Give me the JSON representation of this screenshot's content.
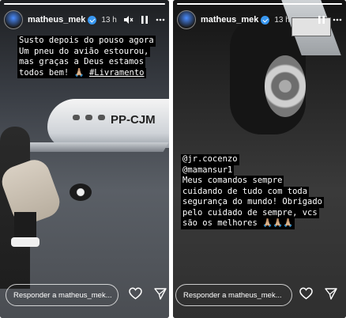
{
  "stories": [
    {
      "username": "matheus_mek",
      "time": "13 h",
      "progress": 1.0,
      "caption": [
        "Susto depois do pouso agora",
        "Um pneu do avião estourou,",
        "mas graças a Deus estamos",
        "todos bem! 🙏🏼"
      ],
      "hashtag": "#Livramento",
      "aircraft_registration": "PP-CJM",
      "reply_placeholder": "Responder a matheus_mek...",
      "icons": [
        "mute-icon",
        "pause-icon",
        "more-icon",
        "heart-icon",
        "send-icon"
      ]
    },
    {
      "username": "matheus_mek",
      "time": "13 h",
      "progress": 1.0,
      "caption": [
        "@jr.cocenzo",
        "@mamansur1",
        "Meus comandos sempre",
        "cuidando de tudo com toda",
        "segurança do mundo! Obrigado",
        "pelo cuidado de sempre, vcs",
        "são os melhores 🙏🏼🙏🏼🙏🏼"
      ],
      "reply_placeholder": "Responder a matheus_mek...",
      "icons": [
        "pause-icon",
        "more-icon",
        "heart-icon",
        "send-icon"
      ]
    }
  ]
}
